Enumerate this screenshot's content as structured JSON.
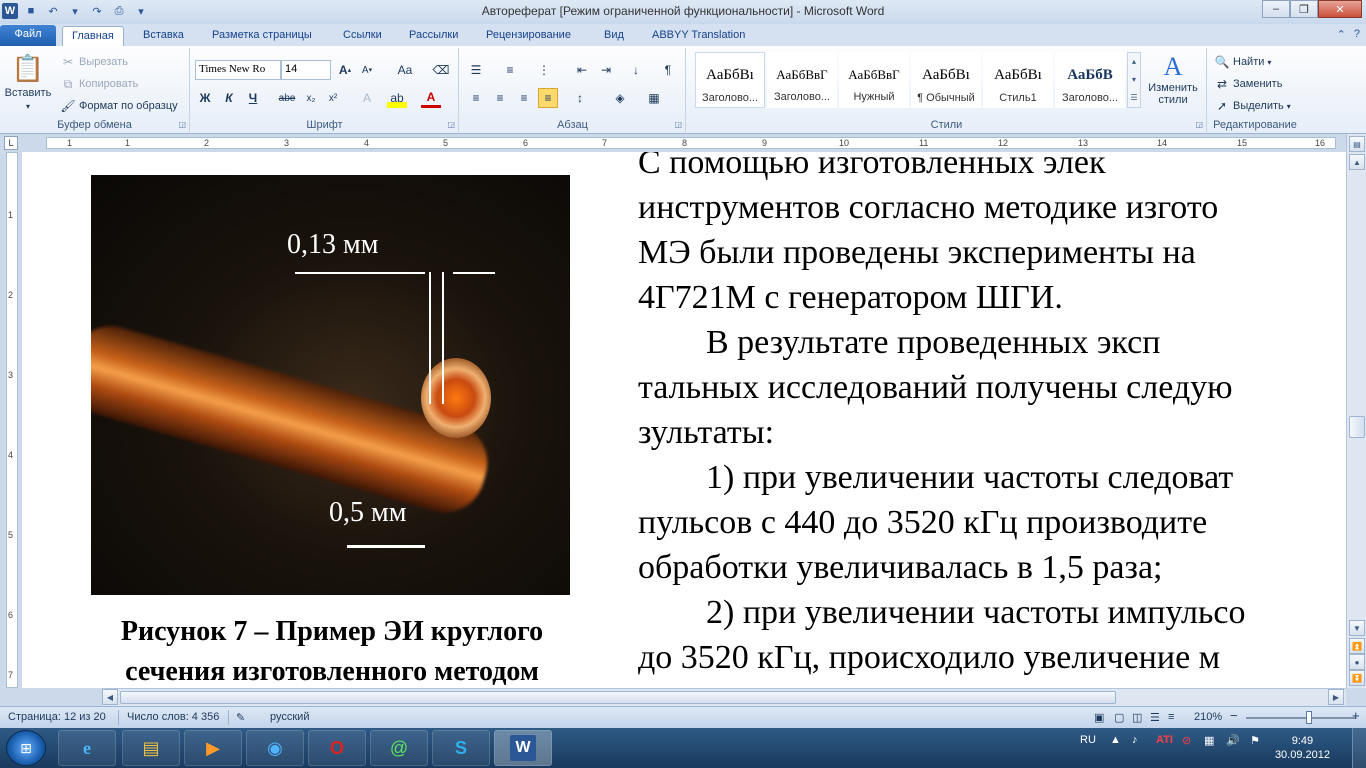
{
  "window": {
    "title": "Автореферат [Режим ограниченной функциональности]  -  Microsoft Word",
    "word_icon": "W",
    "qat_icons": [
      "save-icon",
      "undo-icon",
      "redo-icon",
      "print-icon",
      "customize-icon"
    ]
  },
  "tabs": [
    "Файл",
    "Главная",
    "Вставка",
    "Разметка страницы",
    "Ссылки",
    "Рассылки",
    "Рецензирование",
    "Вид",
    "ABBYY Translation"
  ],
  "ribbon": {
    "clipboard": {
      "label": "Буфер обмена",
      "paste": "Вставить",
      "cut": "Вырезать",
      "copy": "Копировать",
      "format_painter": "Формат по образцу"
    },
    "font": {
      "label": "Шрифт",
      "name": "Times New Ro",
      "size": "14",
      "bold": "Ж",
      "italic": "К",
      "underline": "Ч",
      "strike": "abe",
      "case": "Aa"
    },
    "paragraph": {
      "label": "Абзац",
      "pilcrow": "¶"
    },
    "styles": {
      "label": "Стили",
      "items": [
        {
          "sample": "АаБбВı",
          "name": "Заголово..."
        },
        {
          "sample": "АаБбВвГ",
          "name": "Заголово..."
        },
        {
          "sample": "АаБбВвГ",
          "name": "Нужный"
        },
        {
          "sample": "АаБбВı",
          "name": "¶ Обычный"
        },
        {
          "sample": "АаБбВı",
          "name": "Стиль1"
        },
        {
          "sample": "АаБбВ",
          "name": "Заголово..."
        }
      ],
      "change_styles_line1": "Изменить",
      "change_styles_line2": "стили"
    },
    "editing": {
      "label": "Редактирование",
      "find": "Найти",
      "replace": "Заменить",
      "select": "Выделить"
    }
  },
  "ruler": {
    "h_numbers": [
      "1",
      "1",
      "2",
      "3",
      "4",
      "5",
      "6",
      "7",
      "8",
      "9",
      "10",
      "11",
      "12",
      "13",
      "14",
      "15",
      "16"
    ],
    "v_numbers": [
      "1",
      "2",
      "3",
      "4",
      "5",
      "6",
      "7"
    ]
  },
  "document": {
    "photo_label_1": "0,13 мм",
    "photo_label_2": "0,5 мм",
    "caption_line1": "Рисунок 7 – Пример ЭИ круглого",
    "caption_line2": "сечения изготовленного методом",
    "lines": [
      "С помощью изготовленных элек",
      "инструментов согласно методике изгото",
      "МЭ были проведены эксперименты на",
      "4Г721М с генератором ШГИ.",
      "        В результате проведенных эксп",
      "тальных исследований получены следую",
      "зультаты:",
      "        1) при увеличении частоты следоват",
      "пульсов с 440 до 3520 кГц производите",
      "обработки увеличивалась в 1,5 раза;",
      "        2) при увеличении частоты импульсо",
      "до 3520 кГц, происходило увеличение м"
    ]
  },
  "status": {
    "page": "Страница: 12 из 20",
    "words": "Число слов: 4 356",
    "language": "русский",
    "zoom": "210%",
    "zoom_minus": "−",
    "zoom_plus": "+"
  },
  "taskbar": {
    "lang": "RU",
    "time": "9:49",
    "date": "30.09.2012",
    "apps": [
      "ie-icon",
      "explorer-icon",
      "media-player-icon",
      "maxthon-icon",
      "opera-icon",
      "icq-icon",
      "skype-icon",
      "word-icon"
    ]
  },
  "colors": {
    "file_tab": "#2b5fad",
    "ribbon_bg": "#e6eef8",
    "taskbar": "#1f4570"
  }
}
